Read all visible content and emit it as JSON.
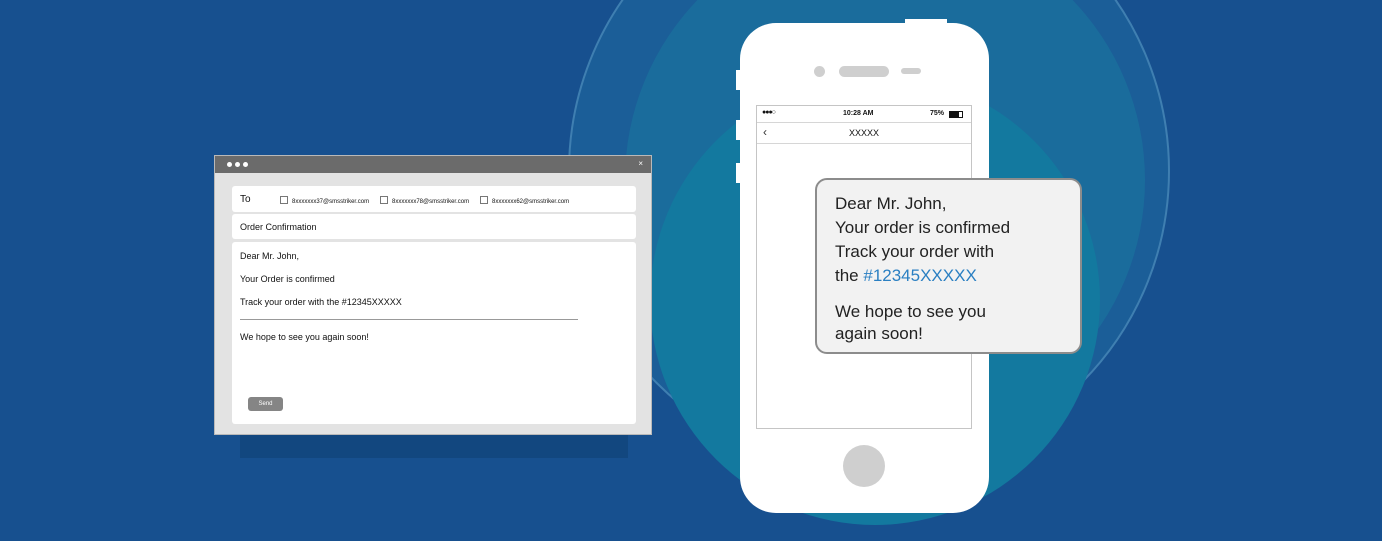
{
  "email": {
    "to_label": "To",
    "recipients": [
      "8xxxxxxx37@smsstriker.com",
      "8xxxxxxx78@smsstriker.com",
      "8xxxxxxx62@smsstriker.com"
    ],
    "subject": "Order Confirmation",
    "body": {
      "greeting": "Dear Mr. John,",
      "line1": "Your Order is confirmed",
      "line2": "Track your order with the #12345XXXXX",
      "closing": "We hope to see you again soon!"
    },
    "send_label": "Send",
    "close_glyph": "×"
  },
  "phone": {
    "status": {
      "signal": "●●●○",
      "time": "10:28 AM",
      "battery": "75%"
    },
    "back_glyph": "‹",
    "contact": "XXXXX"
  },
  "sms": {
    "greeting": "Dear Mr. John,",
    "line1": "Your order is confirmed",
    "line2": "Track your order with",
    "line3_prefix": "the ",
    "order_number": "#12345XXXXX",
    "closing1": "We hope to see you",
    "closing2": "again soon!"
  },
  "colors": {
    "background": "#17508f",
    "accent_link": "#2a7fc2"
  }
}
